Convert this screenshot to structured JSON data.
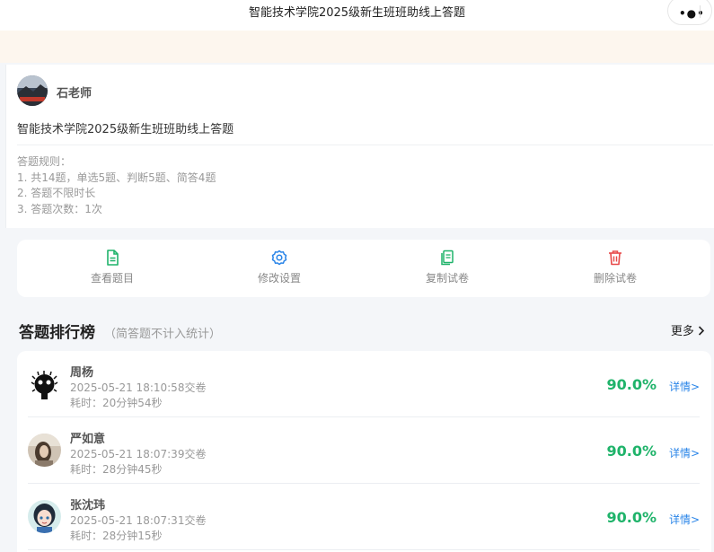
{
  "header": {
    "title": "智能技术学院2025级新生班班助线上答题",
    "menu_glyph": "•●•"
  },
  "author": {
    "name": "石老师"
  },
  "quiz": {
    "title": "智能技术学院2025级新生班班助线上答题",
    "rules": [
      "答题规则：",
      "1. 共14题，单选5题、判断5题、简答4题",
      "2. 答题不限时长",
      "3. 答题次数：1次"
    ]
  },
  "actions": [
    {
      "label": "查看题目",
      "icon": "document-icon",
      "color": "#1fb36a"
    },
    {
      "label": "修改设置",
      "icon": "gear-icon",
      "color": "#2a85e8"
    },
    {
      "label": "复制试卷",
      "icon": "copy-icon",
      "color": "#1fb36a"
    },
    {
      "label": "删除试卷",
      "icon": "trash-icon",
      "color": "#e84a4a"
    }
  ],
  "ranking": {
    "title": "答题排行榜",
    "subtitle": "（简答题不计入统计）",
    "more": "更多",
    "rows": [
      {
        "name": "周杨",
        "time": "2025-05-21 18:10:58交卷",
        "duration": "耗时：20分钟54秒",
        "score": "90.0%",
        "detail": "详情>"
      },
      {
        "name": "严如意",
        "time": "2025-05-21 18:07:39交卷",
        "duration": "耗时：28分钟45秒",
        "score": "90.0%",
        "detail": "详情>"
      },
      {
        "name": "张沈玮",
        "time": "2025-05-21 18:07:31交卷",
        "duration": "耗时：28分钟15秒",
        "score": "90.0%",
        "detail": "详情>"
      }
    ]
  },
  "colors": {
    "score": "#1fb36a",
    "link": "#2a85e8",
    "notice_bg": "#fdf6ee"
  }
}
